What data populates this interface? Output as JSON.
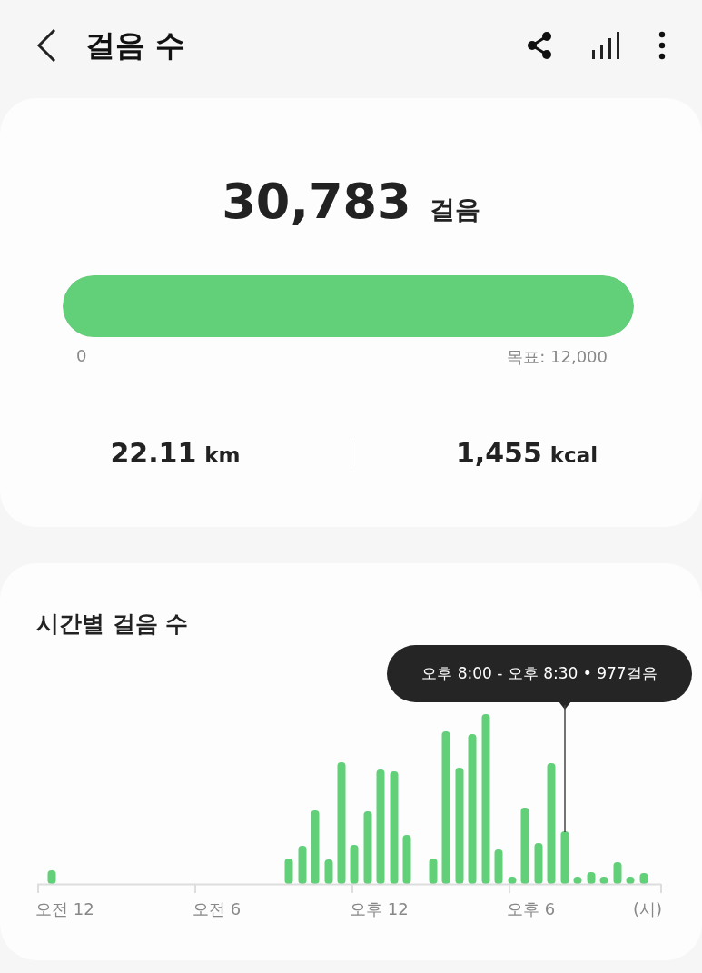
{
  "header": {
    "title": "걸음 수"
  },
  "summary": {
    "steps": "30,783",
    "steps_unit": "걸음",
    "progress": {
      "level": 1.0,
      "start_label": "0",
      "goal_label": "목표: 12,000"
    },
    "stats": [
      {
        "value": "22.11",
        "unit": "km"
      },
      {
        "value": "1,455",
        "unit": "kcal"
      }
    ]
  },
  "hourly": {
    "title": "시간별 걸음 수",
    "tooltip": "오후 8:00 - 오후 8:30 • 977걸음",
    "x_labels": [
      "오전 12",
      "오전 6",
      "오후 12",
      "오후 6",
      "(시)"
    ]
  }
}
